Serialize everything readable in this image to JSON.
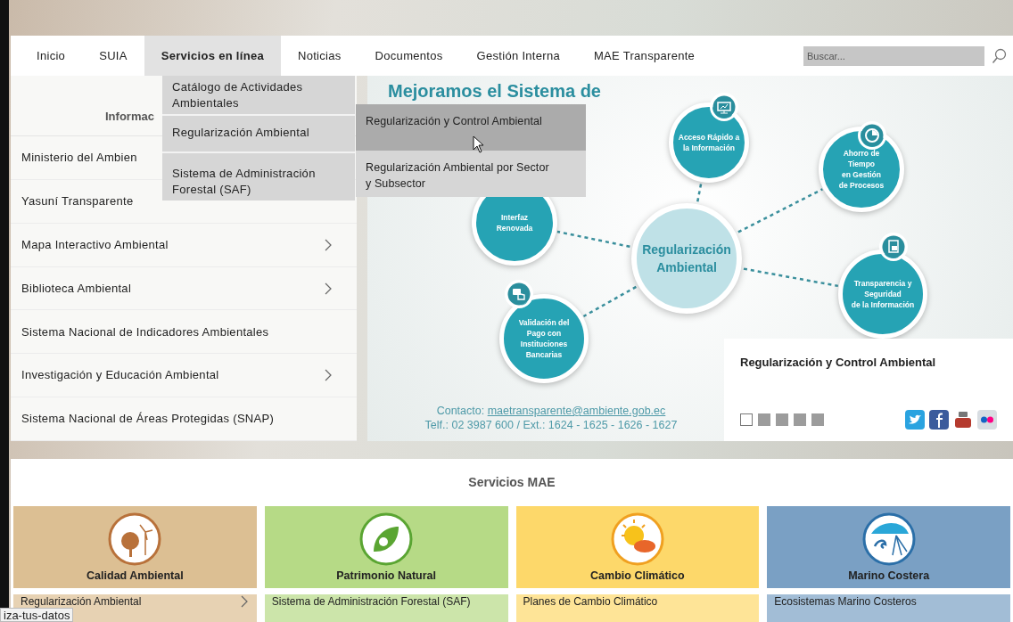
{
  "nav": {
    "items": [
      {
        "label": "Inicio",
        "selected": false
      },
      {
        "label": "SUIA",
        "selected": false
      },
      {
        "label": "Servicios en línea",
        "selected": true
      },
      {
        "label": "Noticias",
        "selected": false
      },
      {
        "label": "Documentos",
        "selected": false
      },
      {
        "label": "Gestión Interna",
        "selected": false
      },
      {
        "label": "MAE Transparente",
        "selected": false
      }
    ],
    "search": {
      "placeholder": "Buscar..."
    }
  },
  "dropdown": {
    "items": [
      "Catálogo de Actividades Ambientales",
      "Regularización Ambiental",
      "Sistema de Administración Forestal (SAF)"
    ],
    "submenu": [
      {
        "label": "Regularización y Control Ambiental",
        "selected": true
      },
      {
        "label": "Regularización Ambiental por Sector y Subsector",
        "selected": false
      }
    ]
  },
  "sidebar": {
    "header": "Informac",
    "items": [
      {
        "label": "Ministerio del Ambien"
      },
      {
        "label": "Yasuní Transparente"
      },
      {
        "label": "Mapa Interactivo Ambiental",
        "has_arrow": true
      },
      {
        "label": "Biblioteca Ambiental",
        "has_arrow": true
      },
      {
        "label": "Sistema Nacional de Indicadores Ambientales",
        "has_arrow": false
      },
      {
        "label": "Investigación y Educación Ambiental",
        "has_arrow": true
      },
      {
        "label": "Sistema Nacional de Áreas Protegidas (SNAP)",
        "has_arrow": false
      }
    ]
  },
  "slide": {
    "title": "Mejoramos el Sistema de",
    "center": "Regularización\nAmbiental",
    "nodes": [
      "Acceso Rápido a\nla Información",
      "Ahorro de\nTiempo\nen Gestión\nde Procesos",
      "Interfaz\nRenovada",
      "Transparencia y\nSeguridad\nde la Información",
      "Validación del\nPago con\nInstituciones\nBancarias"
    ],
    "contact": {
      "label": "Contacto:",
      "email": "maetransparente@ambiente.gob.ec",
      "phone": "Telf.: 02 3987 600 / Ext.: 1624 - 1625 - 1626 - 1627"
    },
    "caption": "Regularización y Control Ambiental",
    "pager": [
      {
        "selected": true
      },
      {
        "selected": false
      },
      {
        "selected": false
      },
      {
        "selected": false
      },
      {
        "selected": false
      }
    ]
  },
  "services": {
    "title": "Servicios MAE",
    "cards": [
      {
        "title": "Calidad Ambiental",
        "color": "#dcbf93",
        "link": "Regularización Ambiental",
        "has_arrow": true
      },
      {
        "title": "Patrimonio Natural",
        "color": "#b6da86",
        "link": "Sistema de Administración Forestal (SAF)",
        "has_arrow": false
      },
      {
        "title": "Cambio Climático",
        "color": "#fdd86a",
        "link": "Planes de Cambio Climático",
        "has_arrow": false
      },
      {
        "title": "Marino Costera",
        "color": "#7aa0c4",
        "link": "Ecosistemas Marino Costeros",
        "has_arrow": false
      }
    ]
  },
  "status_tooltip": "iza-tus-datos"
}
